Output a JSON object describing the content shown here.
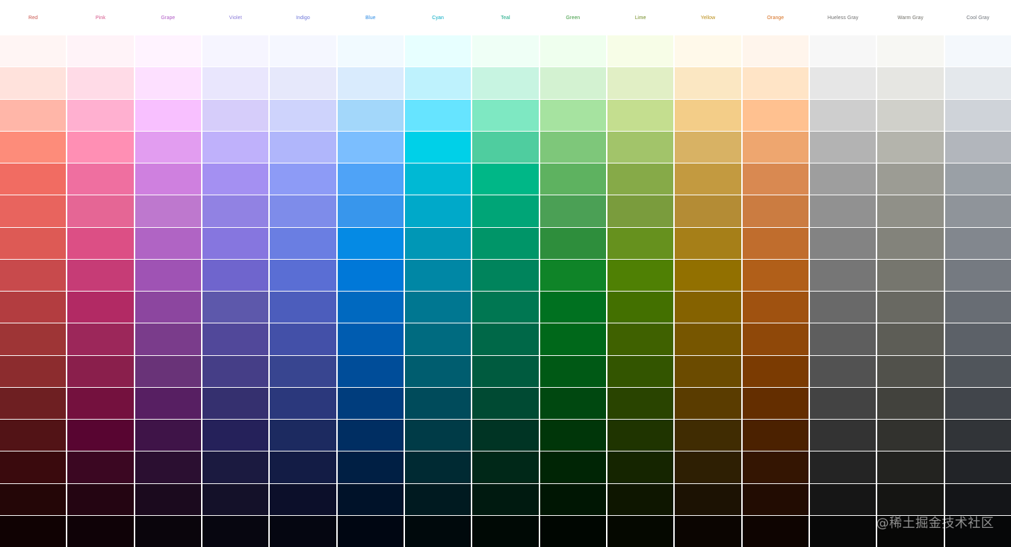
{
  "palette": {
    "hues": [
      {
        "name": "Red",
        "label_color": "#c9544d",
        "swatches": [
          "#fff5f4",
          "#ffe2dc",
          "#ffb6a8",
          "#fd8c7a",
          "#f16c62",
          "#e8645e",
          "#dd5a55",
          "#c84a4c",
          "#b33d40",
          "#9e3536",
          "#8c2c2e",
          "#6e1f22",
          "#521316",
          "#3a0a0d",
          "#240607",
          "#100203"
        ]
      },
      {
        "name": "Pink",
        "label_color": "#d4548a",
        "swatches": [
          "#fff3f8",
          "#ffdbe7",
          "#ffb0d0",
          "#ff8fb4",
          "#ef6fa0",
          "#e56695",
          "#dc4f85",
          "#c63c76",
          "#b22a64",
          "#9c275a",
          "#8a1f4c",
          "#74113e",
          "#580531",
          "#3b0722",
          "#240512",
          "#0f0207"
        ]
      },
      {
        "name": "Grape",
        "label_color": "#b05bc6",
        "swatches": [
          "#fff3ff",
          "#fde0ff",
          "#f8c0ff",
          "#e29df0",
          "#cf80df",
          "#be78ce",
          "#b064c4",
          "#9f53b4",
          "#8c469f",
          "#7a3c8b",
          "#693378",
          "#571f62",
          "#3f1448",
          "#2b0f31",
          "#1b0a1e",
          "#0a050c"
        ]
      },
      {
        "name": "Violet",
        "label_color": "#8a7ad8",
        "swatches": [
          "#f6f5ff",
          "#e9e6fd",
          "#d6cdfa",
          "#bfb1fb",
          "#a490f2",
          "#9182e3",
          "#8676df",
          "#6f65cd",
          "#5d58ab",
          "#51489a",
          "#453e87",
          "#35306f",
          "#25215a",
          "#1b1a40",
          "#141129",
          "#070610"
        ]
      },
      {
        "name": "Indigo",
        "label_color": "#6b74d8",
        "swatches": [
          "#f5f7ff",
          "#e6e8fb",
          "#ced3fc",
          "#b0b6fb",
          "#8d9bf6",
          "#7e8cea",
          "#6a7ee2",
          "#5a6ed4",
          "#4c5dbc",
          "#4350a8",
          "#384590",
          "#2b387c",
          "#1c2a60",
          "#131c45",
          "#0c0f2a",
          "#050611"
        ]
      },
      {
        "name": "Blue",
        "label_color": "#2a8ae4",
        "swatches": [
          "#f1faff",
          "#d9ebfd",
          "#a3d7fa",
          "#7bbefe",
          "#4fa3f7",
          "#3896ec",
          "#058ae4",
          "#0078d8",
          "#0069c0",
          "#005cb0",
          "#004d99",
          "#003d7d",
          "#002e62",
          "#001f44",
          "#001229",
          "#000612"
        ]
      },
      {
        "name": "Cyan",
        "label_color": "#00a9c2",
        "swatches": [
          "#e7ffff",
          "#bef2fd",
          "#66e4ff",
          "#00d0e8",
          "#00b9d4",
          "#00a9c9",
          "#0097b6",
          "#0087a5",
          "#007791",
          "#006b80",
          "#005d6f",
          "#004b5b",
          "#003b47",
          "#002a33",
          "#001a20",
          "#00090c"
        ]
      },
      {
        "name": "Teal",
        "label_color": "#12a680",
        "swatches": [
          "#effff6",
          "#c7f4e1",
          "#7ee8c2",
          "#4fcd9f",
          "#00b787",
          "#00a577",
          "#009568",
          "#00845c",
          "#007752",
          "#006848",
          "#005b3f",
          "#004a33",
          "#003424",
          "#002818",
          "#001a10",
          "#000905"
        ]
      },
      {
        "name": "Green",
        "label_color": "#3b9a3f",
        "swatches": [
          "#efffee",
          "#d3f2d1",
          "#a6e3a0",
          "#7ec77a",
          "#5eb260",
          "#4ba055",
          "#2e8e3c",
          "#0f8428",
          "#007120",
          "#00681a",
          "#005915",
          "#004810",
          "#003609",
          "#002505",
          "#001603",
          "#000601"
        ]
      },
      {
        "name": "Lime",
        "label_color": "#6f8a20",
        "swatches": [
          "#f7fde7",
          "#e1efc5",
          "#c4de8f",
          "#a2c46a",
          "#86aa48",
          "#7a9c3d",
          "#66911e",
          "#4f8004",
          "#437000",
          "#3f6100",
          "#335500",
          "#294400",
          "#1f3400",
          "#152500",
          "#0e1600",
          "#050800"
        ]
      },
      {
        "name": "Yellow",
        "label_color": "#b88a10",
        "swatches": [
          "#fff9ea",
          "#fbe7c2",
          "#f3cd88",
          "#d8b264",
          "#c39a40",
          "#b48c35",
          "#a67f18",
          "#927000",
          "#856200",
          "#775600",
          "#6b4b00",
          "#5a3c00",
          "#402c02",
          "#2e1f03",
          "#1c1203",
          "#0b0501"
        ]
      },
      {
        "name": "Orange",
        "label_color": "#d56d1e",
        "swatches": [
          "#fff5ec",
          "#ffe4c6",
          "#ffc190",
          "#eea66f",
          "#d98951",
          "#cb7c41",
          "#c06d2d",
          "#b15f19",
          "#a05210",
          "#8f4809",
          "#7b3b02",
          "#642e00",
          "#4b2100",
          "#341502",
          "#220c02",
          "#0e0401"
        ]
      },
      {
        "name": "Hueless Gray",
        "label_color": "#6f6f6f",
        "swatches": [
          "#f7f7f7",
          "#e6e6e6",
          "#cecece",
          "#b3b3b3",
          "#9e9e9e",
          "#919191",
          "#838383",
          "#767676",
          "#696969",
          "#5e5e5e",
          "#525252",
          "#434343",
          "#333333",
          "#242424",
          "#161616",
          "#080808"
        ]
      },
      {
        "name": "Warm Gray",
        "label_color": "#6f6e66",
        "swatches": [
          "#f7f7f3",
          "#e6e6e2",
          "#d0d0ca",
          "#b4b4ac",
          "#9c9c94",
          "#909088",
          "#83837b",
          "#76766e",
          "#696962",
          "#5d5d56",
          "#51514b",
          "#42423d",
          "#32322e",
          "#232320",
          "#151513",
          "#070706"
        ]
      },
      {
        "name": "Cool Gray",
        "label_color": "#6c7178",
        "swatches": [
          "#f4f8fc",
          "#e4e8ec",
          "#cfd3d9",
          "#b2b6bc",
          "#9aa0a6",
          "#8f949a",
          "#82878e",
          "#757a81",
          "#686d74",
          "#5c6168",
          "#50555b",
          "#41454b",
          "#313438",
          "#222428",
          "#141518",
          "#060708"
        ]
      }
    ]
  },
  "watermark": {
    "text": "@稀土掘金技术社区"
  }
}
